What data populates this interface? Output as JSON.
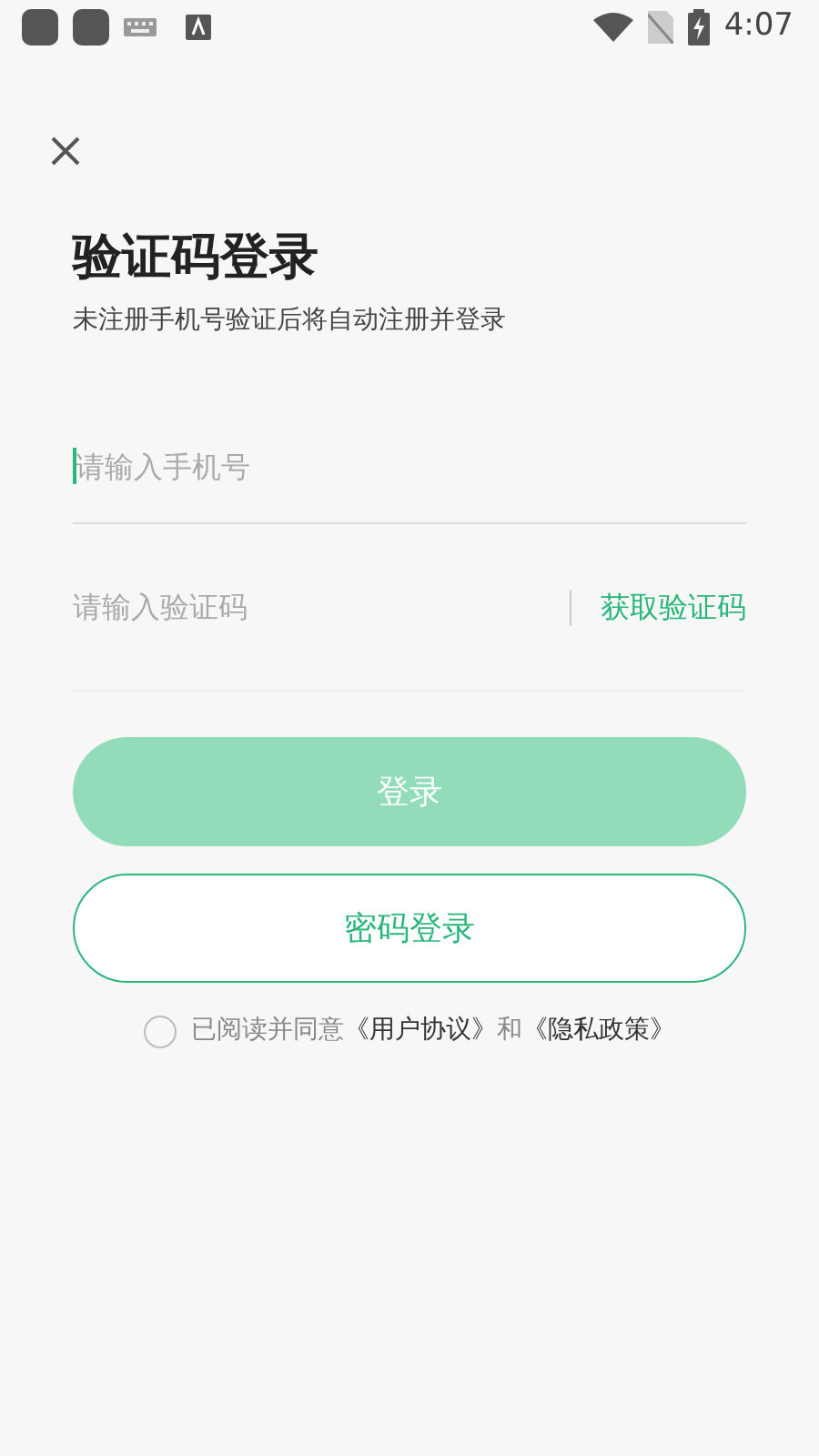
{
  "status_bar": {
    "time": "4:07"
  },
  "title": "验证码登录",
  "subtitle": "未注册手机号验证后将自动注册并登录",
  "phone_field": {
    "placeholder": "请输入手机号",
    "focused": true
  },
  "code_field": {
    "placeholder": "请输入验证码"
  },
  "get_code_button": "获取验证码",
  "login_button": {
    "label": "登录",
    "disabled": true
  },
  "password_login_button": "密码登录",
  "agreement": {
    "checked": false,
    "parts": [
      {
        "kind": "plain",
        "text": "已阅读并同意"
      },
      {
        "kind": "link",
        "text": "《用户协议》"
      },
      {
        "kind": "plain",
        "text": "和"
      },
      {
        "kind": "link",
        "text": "《隐私政策》"
      }
    ]
  }
}
